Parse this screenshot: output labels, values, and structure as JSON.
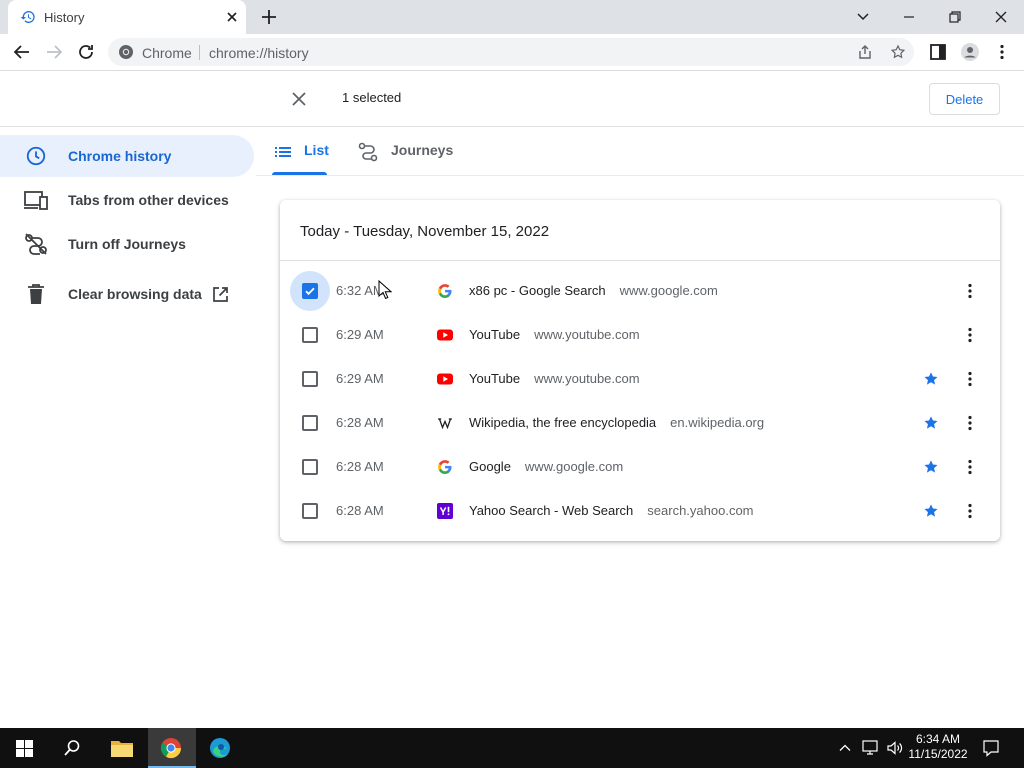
{
  "window": {
    "tab_title": "History"
  },
  "toolbar": {
    "site_chip": "Chrome",
    "url": "chrome://history"
  },
  "selection": {
    "count_text": "1 selected",
    "delete_label": "Delete"
  },
  "sidebar": {
    "items": [
      {
        "label": "Chrome history",
        "icon": "clock-icon",
        "active": true
      },
      {
        "label": "Tabs from other devices",
        "icon": "devices-icon",
        "active": false
      },
      {
        "label": "Turn off Journeys",
        "icon": "journeys-off-icon",
        "active": false
      },
      {
        "label": "Clear browsing data",
        "icon": "trash-icon",
        "active": false
      }
    ]
  },
  "content_tabs": [
    {
      "label": "List",
      "icon": "list-icon",
      "active": true
    },
    {
      "label": "Journeys",
      "icon": "journeys-icon",
      "active": false
    }
  ],
  "history": {
    "date_header": "Today - Tuesday, November 15, 2022",
    "entries": [
      {
        "time": "6:32 AM",
        "title": "x86 pc - Google Search",
        "domain": "www.google.com",
        "favicon": "google",
        "checked": true,
        "bookmarked": false
      },
      {
        "time": "6:29 AM",
        "title": "YouTube",
        "domain": "www.youtube.com",
        "favicon": "youtube",
        "checked": false,
        "bookmarked": false
      },
      {
        "time": "6:29 AM",
        "title": "YouTube",
        "domain": "www.youtube.com",
        "favicon": "youtube",
        "checked": false,
        "bookmarked": true
      },
      {
        "time": "6:28 AM",
        "title": "Wikipedia, the free encyclopedia",
        "domain": "en.wikipedia.org",
        "favicon": "wikipedia",
        "checked": false,
        "bookmarked": true
      },
      {
        "time": "6:28 AM",
        "title": "Google",
        "domain": "www.google.com",
        "favicon": "google",
        "checked": false,
        "bookmarked": true
      },
      {
        "time": "6:28 AM",
        "title": "Yahoo Search - Web Search",
        "domain": "search.yahoo.com",
        "favicon": "yahoo",
        "checked": false,
        "bookmarked": true
      }
    ]
  },
  "taskbar": {
    "time": "6:34 AM",
    "date": "11/15/2022"
  },
  "colors": {
    "accent": "#1a73e8",
    "active_nav_bg": "#e8f0fe",
    "taskbar": "#101010"
  }
}
